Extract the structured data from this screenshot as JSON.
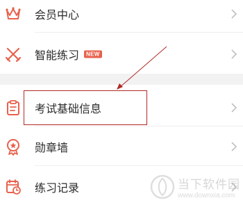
{
  "menu": {
    "items": [
      {
        "label": "会员中心",
        "icon": "crown-icon"
      },
      {
        "label": "智能练习",
        "icon": "crossed-swords-icon",
        "badge": "NEW"
      },
      {
        "label": "考试基础信息",
        "icon": "clipboard-icon"
      },
      {
        "label": "勋章墙",
        "icon": "medal-icon"
      },
      {
        "label": "练习记录",
        "icon": "calendar-clock-icon"
      }
    ]
  },
  "annotation": {
    "arrow": "red-arrow",
    "highlight_color": "#b02a26"
  },
  "watermark": {
    "title": "当下软件园",
    "url": "www.downxia.com"
  },
  "colors": {
    "accent": "#e8614c",
    "text": "#2b2b2b",
    "chevron": "#c0c0c0",
    "section_gap": "#f2f2f2"
  }
}
